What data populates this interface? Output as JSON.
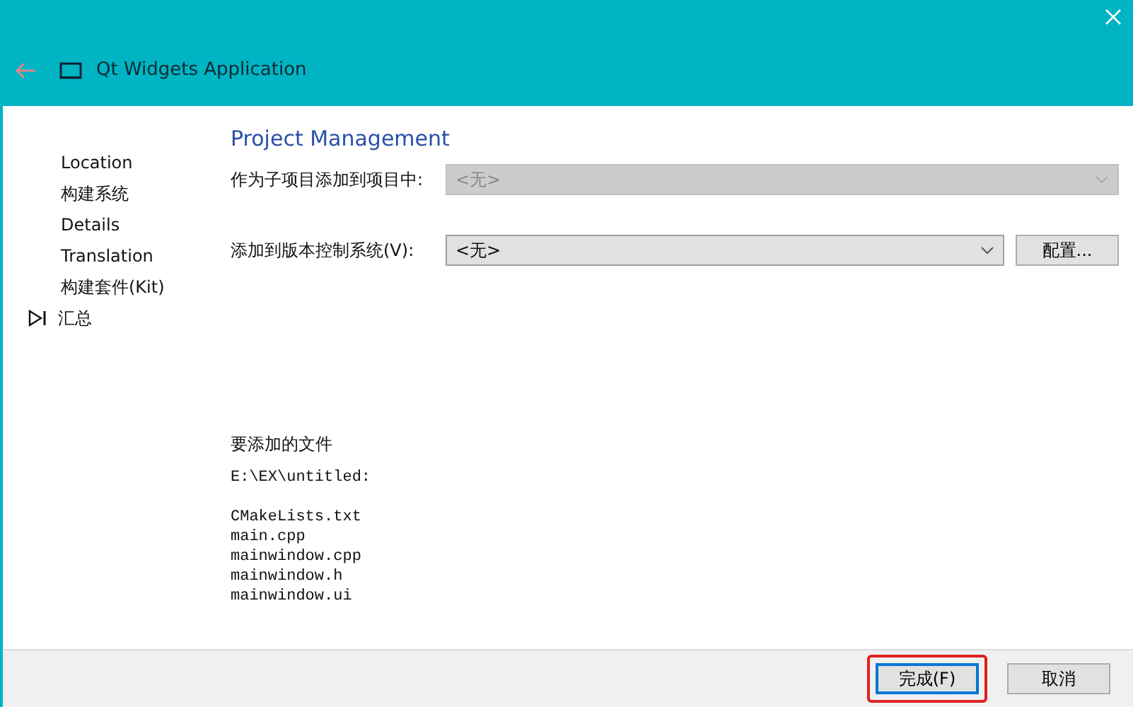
{
  "window": {
    "title": "Qt Widgets Application"
  },
  "sidebar": {
    "items": [
      {
        "label": "Location",
        "selected": false
      },
      {
        "label": "构建系统",
        "selected": false
      },
      {
        "label": "Details",
        "selected": false
      },
      {
        "label": "Translation",
        "selected": false
      },
      {
        "label": "构建套件(Kit)",
        "selected": false
      },
      {
        "label": "汇总",
        "selected": true
      }
    ]
  },
  "page": {
    "heading": "Project Management",
    "fields": [
      {
        "label": "作为子项目添加到项目中:",
        "value": "<无>",
        "disabled": true
      },
      {
        "label": "添加到版本控制系统(V):",
        "value": "<无>",
        "disabled": false,
        "button": "配置..."
      }
    ],
    "files_title": "要添加的文件",
    "directory": "E:\\EX\\untitled:",
    "files": [
      "CMakeLists.txt",
      "main.cpp",
      "mainwindow.cpp",
      "mainwindow.h",
      "mainwindow.ui"
    ]
  },
  "buttons": [
    {
      "label": "完成(F)",
      "default": true,
      "highlighted": true
    },
    {
      "label": "取消",
      "default": false,
      "highlighted": false
    }
  ]
}
